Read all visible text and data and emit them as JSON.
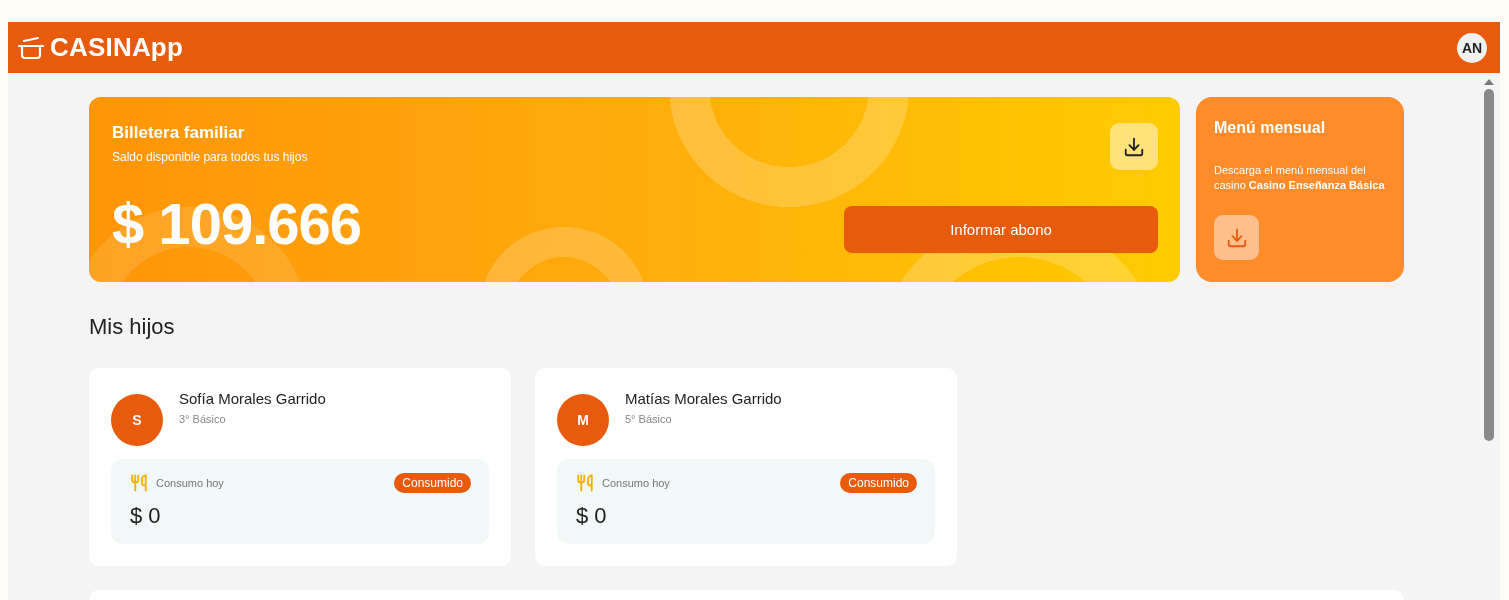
{
  "header": {
    "logo": "CASINApp",
    "user_initials": "AN"
  },
  "wallet": {
    "title": "Billetera familiar",
    "subtitle": "Saldo disponible para todos tus hijos",
    "balance": "$ 109.666",
    "action": "Informar abono"
  },
  "monthly_menu": {
    "title": "Menú mensual",
    "description": "Descarga el menú mensual del casino **Casino Enseñanza Básica**"
  },
  "children_section": {
    "title": "Mis hijos",
    "children": [
      {
        "initial": "S",
        "name": "Sofía Morales Garrido",
        "grade": "3° Básico",
        "consumption_label": "Consumo hoy",
        "status": "Consumido",
        "amount": "$ 0"
      },
      {
        "initial": "M",
        "name": "Matías Morales Garrido",
        "grade": "5° Básico",
        "consumption_label": "Consumo hoy",
        "status": "Consumido",
        "amount": "$ 0"
      }
    ]
  }
}
